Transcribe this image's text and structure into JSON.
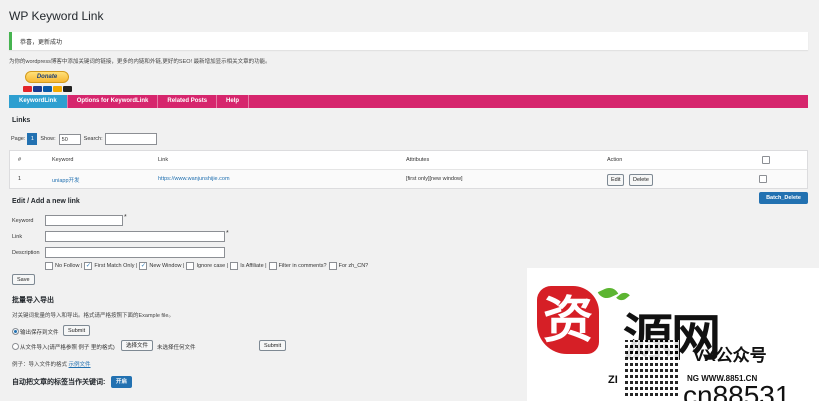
{
  "page": {
    "title": "WP Keyword Link"
  },
  "notice": {
    "text": "恭喜，更新成功"
  },
  "intro": "为你的wordpress博客中添加关键词的链接，更多的内链和外链,更好的SEO! 最新增加显示相关文章的功能。",
  "donate": {
    "label": "Donate",
    "cards": [
      "#e3242b",
      "#1a3a8f",
      "#0a5aa8",
      "#f2a900",
      "#222222"
    ]
  },
  "tabs": [
    {
      "label": "KeywordLink",
      "active": true
    },
    {
      "label": "Options for KeywordLink",
      "active": false
    },
    {
      "label": "Related Posts",
      "active": false
    },
    {
      "label": "Help",
      "active": false
    }
  ],
  "links": {
    "heading": "Links",
    "page_label": "Page:",
    "current_page": "1",
    "show_label": "Show:",
    "show_value": "50",
    "search_label": "Search:",
    "search_value": "",
    "columns": {
      "num": "#",
      "keyword": "Keyword",
      "link": "Link",
      "attributes": "Attributes",
      "action": "Action"
    },
    "rows": [
      {
        "num": "1",
        "keyword": "uniapp开发",
        "link": "https://www.wanjunshijie.com",
        "attributes": "[first only][new window]",
        "edit_label": "Edit",
        "delete_label": "Delete"
      }
    ],
    "batch_delete_label": "Batch_Delete"
  },
  "add": {
    "heading": "Edit / Add a new link",
    "keyword_label": "Keyword",
    "keyword_value": "",
    "link_label": "Link",
    "link_value": "",
    "description_label": "Description",
    "description_value": "",
    "required_mark": "*",
    "options": [
      {
        "label": "No Follow |",
        "checked": false
      },
      {
        "label": "First Match Only |",
        "checked": true
      },
      {
        "label": "New Window |",
        "checked": true
      },
      {
        "label": "Ignore case |",
        "checked": false
      },
      {
        "label": "Is Affiliate |",
        "checked": false
      },
      {
        "label": "Filter in comments?",
        "checked": false
      },
      {
        "label": "For zh_CN?",
        "checked": false
      }
    ],
    "save_label": "Save"
  },
  "import": {
    "heading": "批量导入导出",
    "description": "对关键词批量的导入和导出。格式请严格按照下面的Example file。",
    "export_label": "输出保存到文件",
    "export_submit": "Submit",
    "import_label": "从文件导入(请严格参照 例子 里的格式)",
    "choose_file_label": "选择文件",
    "no_file_label": "未选择任何文件",
    "import_submit": "Submit",
    "example_prefix": "例子：导入文件的格式",
    "example_link": "示例文件"
  },
  "auto": {
    "heading": "自动把文章的标签当作关键词:",
    "button": "开启"
  },
  "watermark": {
    "seal": "资",
    "big": "源网",
    "vx": "VX公众号",
    "zi": "ZI",
    "url": "NG WWW.8851.CN",
    "cn": "cn88531"
  }
}
